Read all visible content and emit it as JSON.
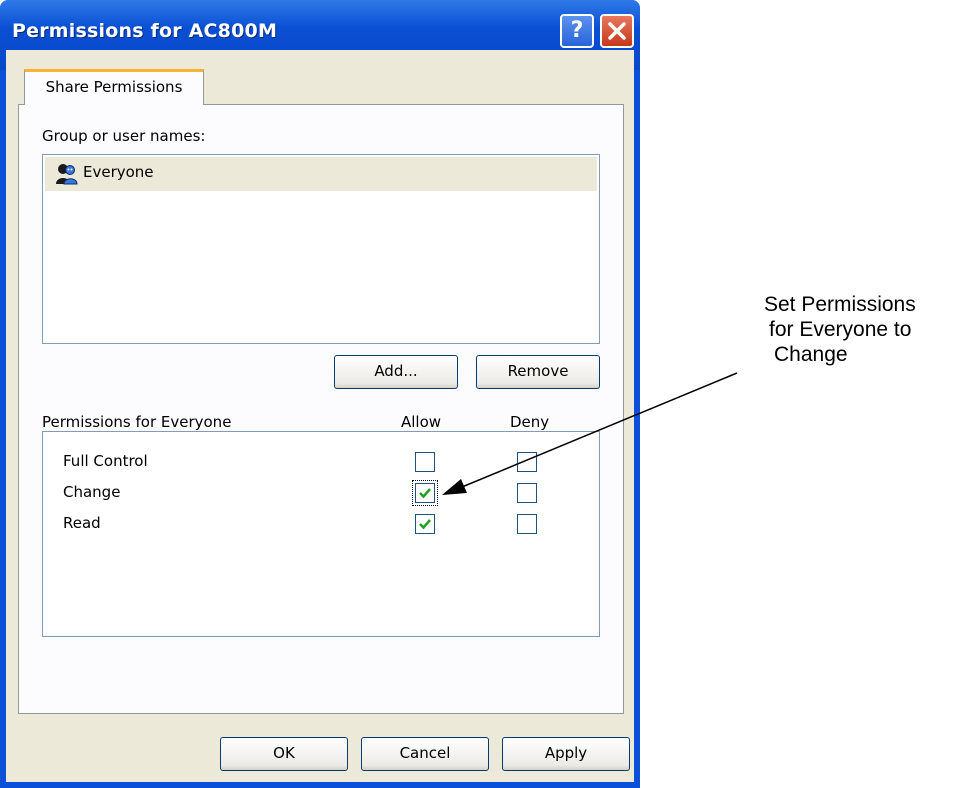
{
  "window": {
    "title": "Permissions for AC800M"
  },
  "tabs": [
    {
      "label": "Share Permissions"
    }
  ],
  "group_section": {
    "label": "Group or user names:",
    "items": [
      {
        "label": "Everyone",
        "icon": "users-group-icon"
      }
    ],
    "add_label": "Add...",
    "remove_label": "Remove"
  },
  "permissions": {
    "header": "Permissions for Everyone",
    "allow_header": "Allow",
    "deny_header": "Deny",
    "rows": [
      {
        "label": "Full Control",
        "allow": false,
        "deny": false
      },
      {
        "label": "Change",
        "allow": true,
        "deny": false
      },
      {
        "label": "Read",
        "allow": true,
        "deny": false
      }
    ]
  },
  "footer": {
    "ok_label": "OK",
    "cancel_label": "Cancel",
    "apply_label": "Apply"
  },
  "annotation": {
    "lines": [
      "Set Permissions",
      "for Everyone to",
      "Change"
    ]
  },
  "colors": {
    "titlebar": "#0a50d8",
    "tab_accent": "#f8b234",
    "check": "#21a121"
  }
}
